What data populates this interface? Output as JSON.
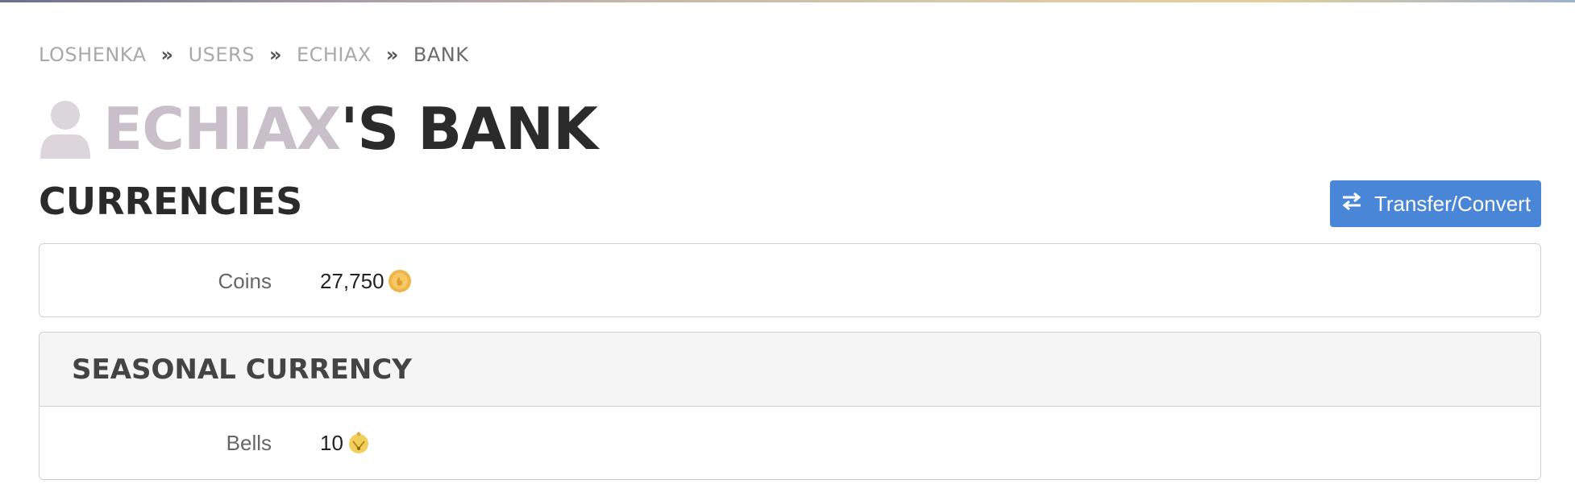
{
  "breadcrumb": {
    "items": [
      "LOSHENKA",
      "USERS",
      "ECHIAX",
      "BANK"
    ],
    "separator": "»"
  },
  "title": {
    "user_name": "ECHIAX",
    "suffix": "'S BANK",
    "icon": "user-icon"
  },
  "currencies": {
    "heading": "CURRENCIES",
    "transfer_button_label": "Transfer/Convert",
    "transfer_icon": "exchange-icon",
    "coins": {
      "label": "Coins",
      "value": "27,750",
      "icon": "coin-icon"
    }
  },
  "seasonal": {
    "heading": "SEASONAL CURRENCY",
    "bells": {
      "label": "Bells",
      "value": "10",
      "icon": "bell-icon"
    }
  },
  "colors": {
    "accent": "#4a86d8",
    "username": "#c9bfc8",
    "heading": "#2b2b2b"
  }
}
